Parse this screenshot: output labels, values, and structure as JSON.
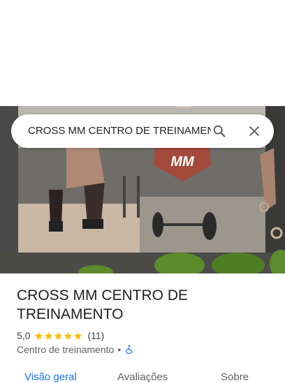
{
  "search": {
    "query": "CROSS MM CENTRO DE TREINAMENTO"
  },
  "hero": {
    "logo_text": "MM"
  },
  "place": {
    "name": "CROSS MM CENTRO DE TREINAMENTO",
    "rating": "5,0",
    "stars": 5,
    "review_count": "(11)",
    "category": "Centro de treinamento",
    "separator": "•",
    "accessibility_icon": "wheelchair-icon"
  },
  "tabs": [
    {
      "label": "Visão geral",
      "active": true
    },
    {
      "label": "Avaliações",
      "active": false
    },
    {
      "label": "Sobre",
      "active": false
    }
  ],
  "colors": {
    "accent": "#1a73e8",
    "star": "#fbbc04",
    "text": "#202124",
    "muted": "#5f6368"
  }
}
